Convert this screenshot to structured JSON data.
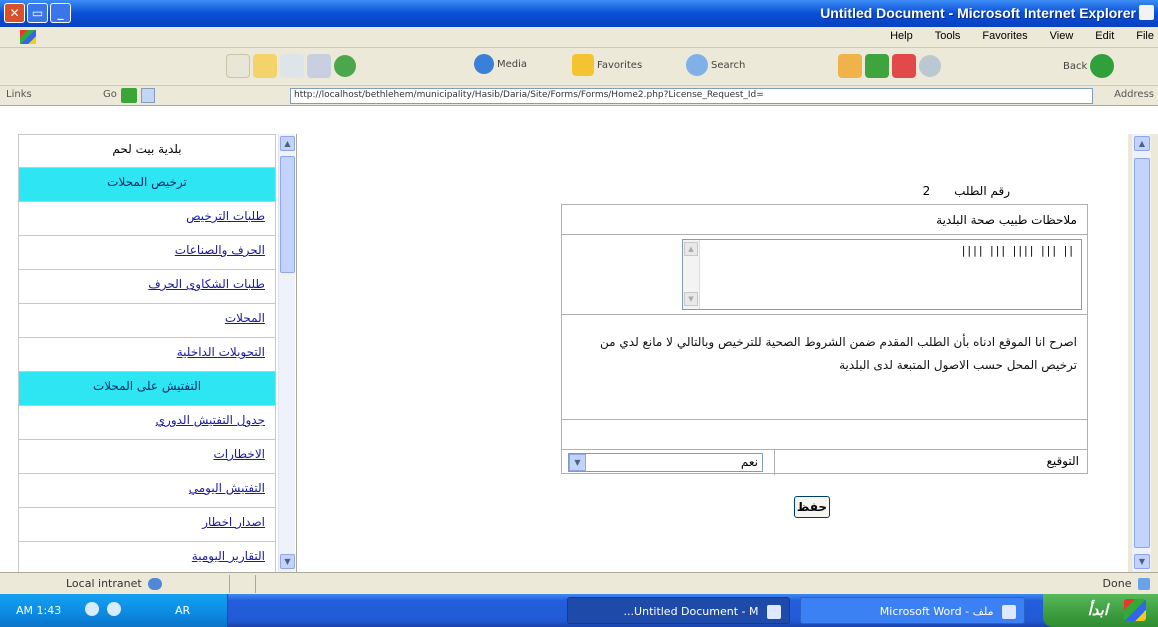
{
  "window": {
    "title": "Untitled Document - Microsoft Internet Explorer"
  },
  "menu": [
    "Help",
    "Tools",
    "Favorites",
    "View",
    "Edit",
    "File"
  ],
  "toolbar": {
    "media": "Media",
    "favorites": "Favorites",
    "search": "Search",
    "back": "Back"
  },
  "addressbar": {
    "links": "Links",
    "go": "Go",
    "address_label": "Address",
    "url": "http://localhost/bethlehem/municipality/Hasib/Daria/Site/Forms/Forms/Home2.php?License_Request_Id=",
    "icons": {
      "go": "go-arrow-icon",
      "dropdown": "dropdown-arrow-icon"
    }
  },
  "sidebar": {
    "header": "بلدية بيت لحم",
    "items": [
      {
        "label": "ترخيص المحلات",
        "type": "section"
      },
      {
        "label": "طلبات الترخيص",
        "type": "link"
      },
      {
        "label": "الحرف والصناعات",
        "type": "link"
      },
      {
        "label": "طلبات الشكاوى الحرف",
        "type": "link"
      },
      {
        "label": "المحلات",
        "type": "link"
      },
      {
        "label": "التحويلات الداخلية",
        "type": "link"
      },
      {
        "label": "التفتيش على المحلات",
        "type": "section"
      },
      {
        "label": "جدول التفتيش الدوري",
        "type": "link"
      },
      {
        "label": "الاخطارات",
        "type": "link"
      },
      {
        "label": "التفتيش اليومي",
        "type": "link"
      },
      {
        "label": "اصدار اخطار",
        "type": "link"
      },
      {
        "label": "التقارير اليومية",
        "type": "link"
      }
    ]
  },
  "main": {
    "app_number_label": "رقم الطلب",
    "app_number_value": "2",
    "notes_title": "ملاحظات طبيب صحة البلدية",
    "notes_value": "|| ||| |||| ||| ||||",
    "declaration": "اصرح انا الموقع ادناه بأن الطلب المقدم ضمن الشروط الصحية للترخيص وبالتالي لا مانع لدي من ترخيص المحل حسب الاصول المتبعة لدى البلدية",
    "signature_label": "التوقيع",
    "signature_value": "نعم",
    "save_button": "حفظ"
  },
  "statusbar": {
    "zone": "Local intranet",
    "done": "Done"
  },
  "taskbar": {
    "time": "AM 1:43",
    "lang": "AR",
    "task_ie": "Untitled Document - M...",
    "task_word": "ملف - Microsoft Word",
    "start": "ابدأ"
  },
  "colors": {
    "section_bg": "#2ee6f1",
    "link": "#1a1a9e",
    "titlebar": "#0a4fd6",
    "start": "#3c9c3f"
  }
}
